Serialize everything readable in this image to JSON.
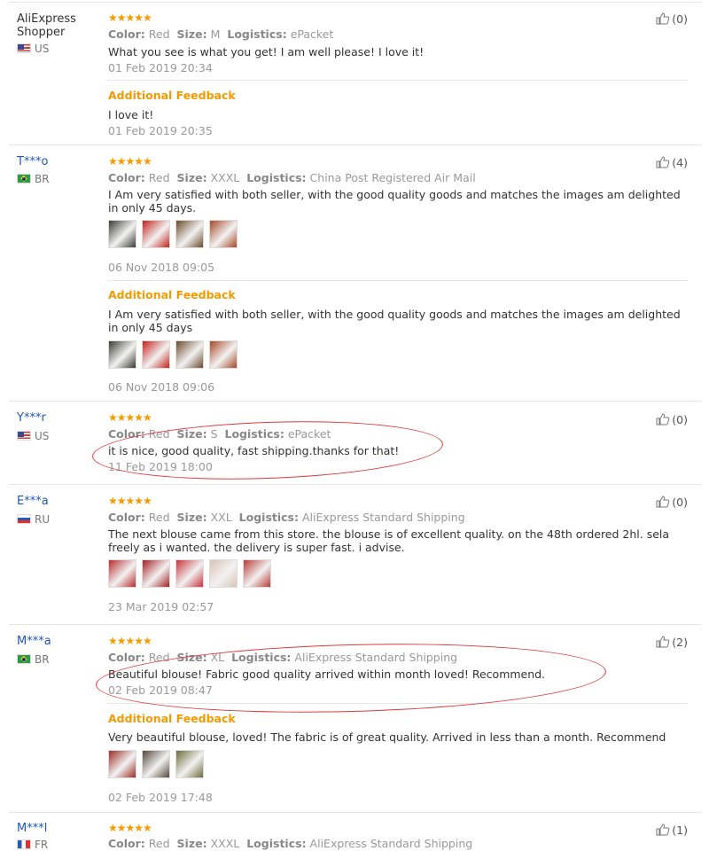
{
  "labels": {
    "color": "Color:",
    "size": "Size:",
    "logistics": "Logistics:",
    "additional": "Additional Feedback"
  },
  "colors": {
    "accent": "#f39b00",
    "link": "#1f57b5",
    "annotation": "#e0383a"
  },
  "reviews": [
    {
      "name": "AliExpress Shopper",
      "country": "US",
      "stars": "★★★★★",
      "color": "Red",
      "size": "M",
      "logistics": "ePacket",
      "text": "What you see is what you get! I am well please! I love it!",
      "date": "01 Feb 2019 20:34",
      "likes": "(0)",
      "additional": {
        "text": "I love it!",
        "date": "01 Feb 2019 20:35"
      }
    },
    {
      "name": "T***o",
      "country": "BR",
      "stars": "★★★★★",
      "color": "Red",
      "size": "XXXL",
      "logistics": "China Post Registered Air Mail",
      "text": "I Am very satisfied with both seller, with the good quality goods and matches the images am delighted in only 45 days.",
      "date": "06 Nov 2018 09:05",
      "likes": "(4)",
      "photos": [
        "#3b3a33",
        "#c4221b",
        "#6b4a2c",
        "#a84726"
      ],
      "additional": {
        "text": "I Am very satisfied with both seller, with the good quality goods and matches the images am delighted in only 45 days",
        "date": "06 Nov 2018 09:06",
        "photos": [
          "#3b3a33",
          "#c4221b",
          "#6b4a2c",
          "#a84726"
        ]
      }
    },
    {
      "name": "Y***r",
      "country": "US",
      "stars": "★★★★★",
      "color": "Red",
      "size": "S",
      "logistics": "ePacket",
      "text": "it is nice, good quality, fast shipping.thanks for that!",
      "date": "11 Feb 2019 18:00",
      "likes": "(0)"
    },
    {
      "name": "E***a",
      "country": "RU",
      "stars": "★★★★★",
      "color": "Red",
      "size": "XXL",
      "logistics": "AliExpress Standard Shipping",
      "text": "The next blouse came from this store. the blouse is of excellent quality. on the 48th ordered 2hl. sela freely as i wanted. the delivery is super fast. i advise.",
      "date": "23 Mar 2019 02:57",
      "likes": "(0)",
      "photos": [
        "#b92a2a",
        "#a51f24",
        "#c8323a",
        "#d9c3b6",
        "#b83a34"
      ]
    },
    {
      "name": "M***a",
      "country": "BR",
      "stars": "★★★★★",
      "color": "Red",
      "size": "XL",
      "logistics": "AliExpress Standard Shipping",
      "text": "Beautiful blouse! Fabric good quality arrived within month loved! Recommend.",
      "date": "02 Feb 2019 08:47",
      "likes": "(2)",
      "additional": {
        "text": "Very beautiful blouse, loved! The fabric is of great quality. Arrived in less than a month. Recommend",
        "date": "02 Feb 2019 17:48",
        "photos": [
          "#9d2a22",
          "#55473b",
          "#6e6a3b"
        ]
      }
    },
    {
      "name": "M***l",
      "country": "FR",
      "stars": "★★★★★",
      "color": "Red",
      "size": "XXXL",
      "logistics": "AliExpress Standard Shipping",
      "likes": "(1)"
    }
  ]
}
